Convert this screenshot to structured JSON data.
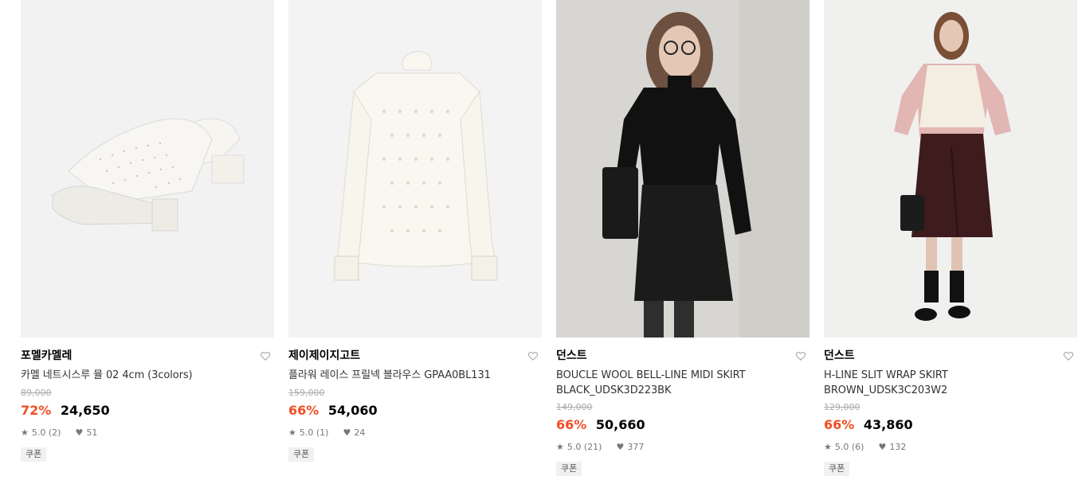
{
  "products": [
    {
      "brand": "포멜카멜레",
      "name": "카멜 네트시스루 뮬 02 4cm (3colors)",
      "original_price": "89,000",
      "discount": "72%",
      "price": "24,650",
      "rating": "5.0 (2)",
      "likes": "51",
      "coupon": "쿠폰"
    },
    {
      "brand": "제이제이지고트",
      "name": "플라워 레이스 프릴넥 블라우스 GPAA0BL131",
      "original_price": "159,000",
      "discount": "66%",
      "price": "54,060",
      "rating": "5.0 (1)",
      "likes": "24",
      "coupon": "쿠폰"
    },
    {
      "brand": "던스트",
      "name": "BOUCLE WOOL BELL-LINE MIDI SKIRT BLACK_UDSK3D223BK",
      "original_price": "149,000",
      "discount": "66%",
      "price": "50,660",
      "rating": "5.0 (21)",
      "likes": "377",
      "coupon": "쿠폰"
    },
    {
      "brand": "던스트",
      "name": "H-LINE SLIT WRAP SKIRT BROWN_UDSK3C203W2",
      "original_price": "129,000",
      "discount": "66%",
      "price": "43,860",
      "rating": "5.0 (6)",
      "likes": "132",
      "coupon": "쿠폰"
    }
  ],
  "colors": {
    "discount": "#f04e23",
    "text": "#000000",
    "muted": "#777777"
  },
  "icons": {
    "like": "heart-outline-icon",
    "star": "star-icon",
    "likes_count": "heart-filled-icon"
  }
}
